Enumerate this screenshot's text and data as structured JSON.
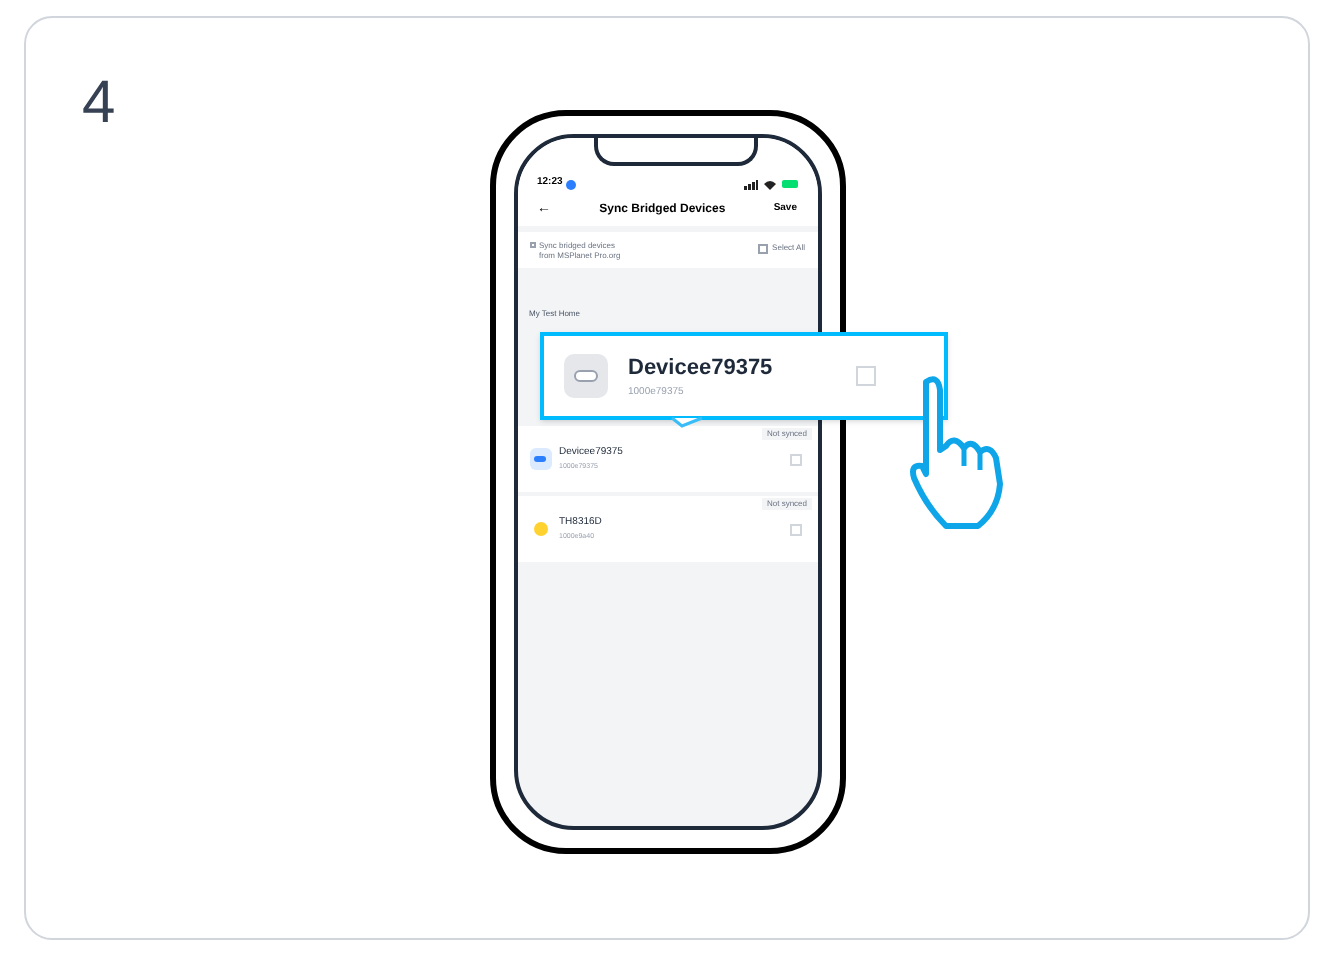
{
  "step": "4",
  "status_bar": {
    "time": "12:23"
  },
  "header": {
    "back": "←",
    "title": "Sync Bridged Devices",
    "action": "Save"
  },
  "sync_option": {
    "lines": [
      "Sync bridged devices",
      "from MSPlanet Pro.org"
    ],
    "checked": false
  },
  "select_all": {
    "label": "Select All",
    "checked": false
  },
  "home": "My Test Home",
  "devices": [
    {
      "kind": "plug",
      "name": "Devicee79375",
      "id": "1000e79375",
      "badge": "Not synced",
      "checked": false
    },
    {
      "kind": "bulb",
      "name": "TH8316D",
      "id": "1000e9a40",
      "badge": "Not synced",
      "checked": false
    }
  ],
  "callout": {
    "kind": "plug",
    "name": "Devicee79375",
    "id": "1000e79375",
    "checked": false
  }
}
